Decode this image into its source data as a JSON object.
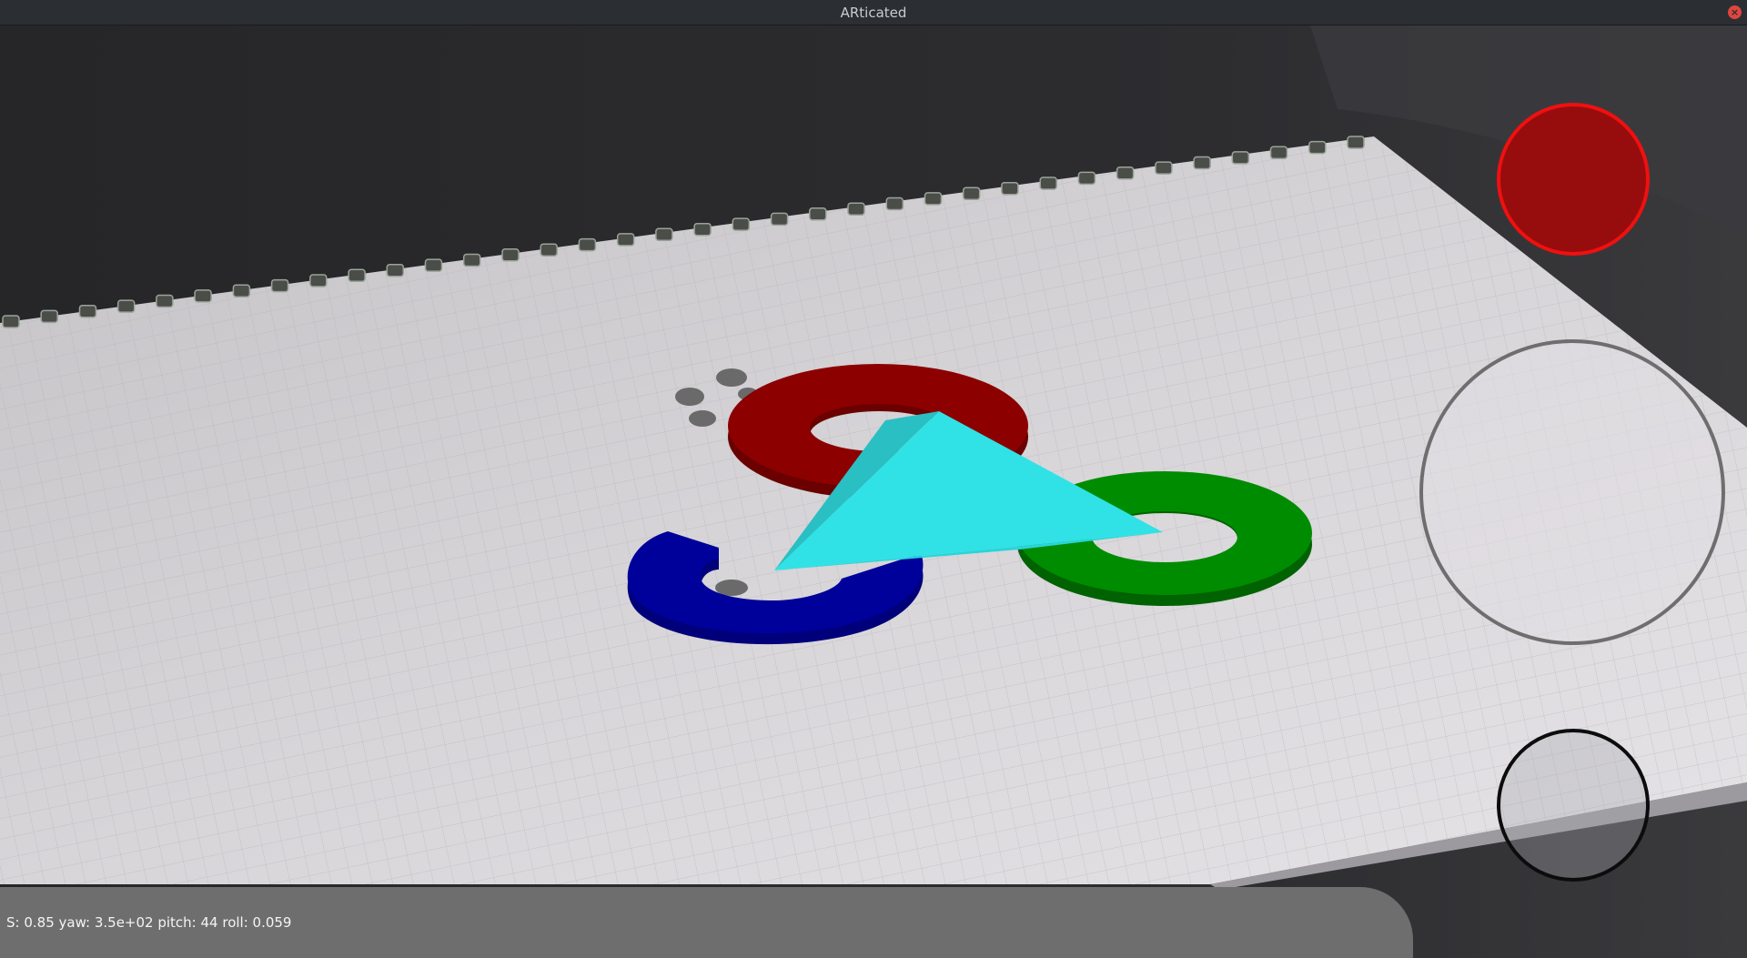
{
  "window": {
    "title": "ARticated"
  },
  "status": {
    "text": "S: 0.85 yaw: 3.5e+02 pitch: 44 roll: 0.059"
  },
  "colors": {
    "red_ring": "#8b0000",
    "green_ring": "#008c00",
    "blue_ring": "#00009a",
    "pyramid": "#30e2e6",
    "red_button": "#f01010"
  },
  "icons": {
    "close": "close-icon"
  }
}
